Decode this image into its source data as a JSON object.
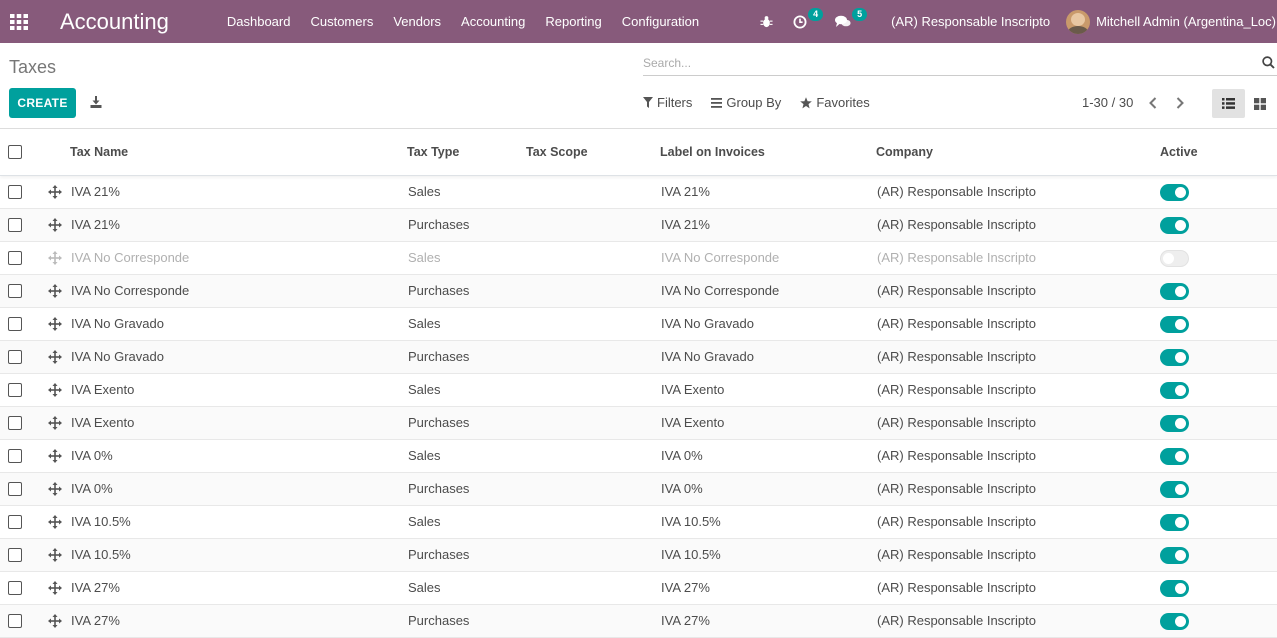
{
  "navbar": {
    "brand": "Accounting",
    "menu": [
      "Dashboard",
      "Customers",
      "Vendors",
      "Accounting",
      "Reporting",
      "Configuration"
    ],
    "activities_count": "4",
    "messages_count": "5",
    "company": "(AR) Responsable Inscripto",
    "user": "Mitchell Admin (Argentina_Loc)"
  },
  "control": {
    "breadcrumb": "Taxes",
    "search_placeholder": "Search...",
    "create_label": "CREATE",
    "filters_label": "Filters",
    "groupby_label": "Group By",
    "favorites_label": "Favorites",
    "pager": "1-30 / 30"
  },
  "table": {
    "headers": {
      "name": "Tax Name",
      "type": "Tax Type",
      "scope": "Tax Scope",
      "label": "Label on Invoices",
      "company": "Company",
      "active": "Active"
    },
    "rows": [
      {
        "name": "IVA 21%",
        "type": "Sales",
        "label": "IVA 21%",
        "company": "(AR) Responsable Inscripto",
        "active": true
      },
      {
        "name": "IVA 21%",
        "type": "Purchases",
        "label": "IVA 21%",
        "company": "(AR) Responsable Inscripto",
        "active": true
      },
      {
        "name": "IVA No Corresponde",
        "type": "Sales",
        "label": "IVA No Corresponde",
        "company": "(AR) Responsable Inscripto",
        "active": false
      },
      {
        "name": "IVA No Corresponde",
        "type": "Purchases",
        "label": "IVA No Corresponde",
        "company": "(AR) Responsable Inscripto",
        "active": true
      },
      {
        "name": "IVA No Gravado",
        "type": "Sales",
        "label": "IVA No Gravado",
        "company": "(AR) Responsable Inscripto",
        "active": true
      },
      {
        "name": "IVA No Gravado",
        "type": "Purchases",
        "label": "IVA No Gravado",
        "company": "(AR) Responsable Inscripto",
        "active": true
      },
      {
        "name": "IVA Exento",
        "type": "Sales",
        "label": "IVA Exento",
        "company": "(AR) Responsable Inscripto",
        "active": true
      },
      {
        "name": "IVA Exento",
        "type": "Purchases",
        "label": "IVA Exento",
        "company": "(AR) Responsable Inscripto",
        "active": true
      },
      {
        "name": "IVA 0%",
        "type": "Sales",
        "label": "IVA 0%",
        "company": "(AR) Responsable Inscripto",
        "active": true
      },
      {
        "name": "IVA 0%",
        "type": "Purchases",
        "label": "IVA 0%",
        "company": "(AR) Responsable Inscripto",
        "active": true
      },
      {
        "name": "IVA 10.5%",
        "type": "Sales",
        "label": "IVA 10.5%",
        "company": "(AR) Responsable Inscripto",
        "active": true
      },
      {
        "name": "IVA 10.5%",
        "type": "Purchases",
        "label": "IVA 10.5%",
        "company": "(AR) Responsable Inscripto",
        "active": true
      },
      {
        "name": "IVA 27%",
        "type": "Sales",
        "label": "IVA 27%",
        "company": "(AR) Responsable Inscripto",
        "active": true
      },
      {
        "name": "IVA 27%",
        "type": "Purchases",
        "label": "IVA 27%",
        "company": "(AR) Responsable Inscripto",
        "active": true
      }
    ]
  },
  "colors": {
    "navbar": "#875a7b",
    "primary": "#00a09d"
  },
  "icons": {
    "apps": "grid-icon",
    "debug": "bug-icon",
    "activities": "clock-icon",
    "messages": "chat-icon",
    "search": "search-icon",
    "download": "download-icon",
    "filters": "filter-icon",
    "groupby": "bars-icon",
    "favorites": "star-icon",
    "drag": "move-handle-icon"
  }
}
